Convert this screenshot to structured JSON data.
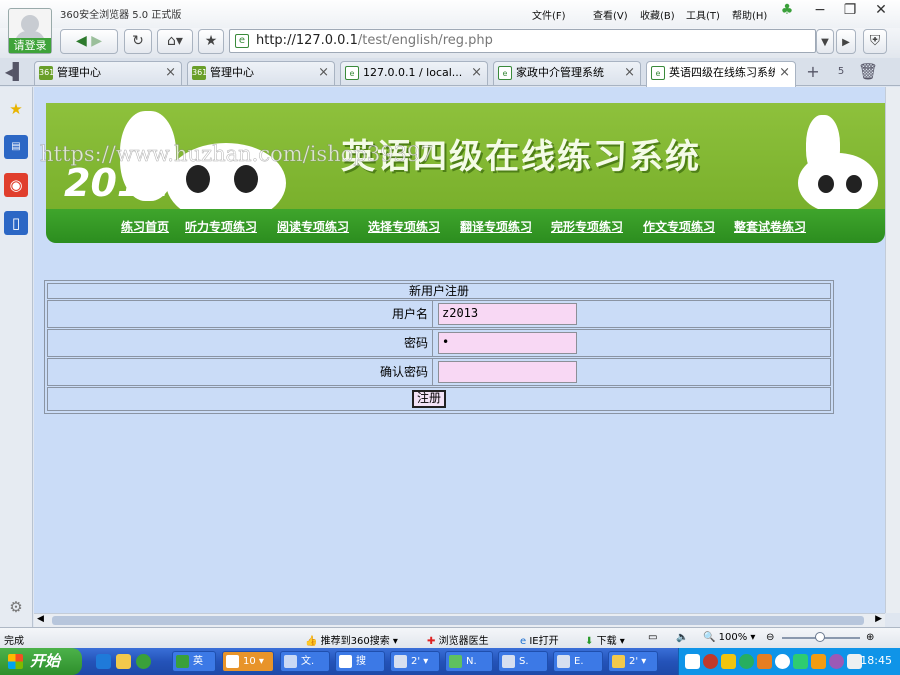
{
  "browser": {
    "app_title": "360安全浏览器 5.0 正式版",
    "login_label": "请登录",
    "menus": [
      "文件(F)",
      "查看(V)",
      "收藏(B)",
      "工具(T)",
      "帮助(H)"
    ],
    "url_host": "http://127.0.0.1",
    "url_path": "/test/english/reg.php",
    "tab_count": "5"
  },
  "tabs": [
    {
      "label": "管理中心",
      "icon": "360-icon"
    },
    {
      "label": "管理中心",
      "icon": "360-icon"
    },
    {
      "label": "127.0.0.1 / local...",
      "icon": "page-icon"
    },
    {
      "label": "家政中介管理系统",
      "icon": "page-icon"
    },
    {
      "label": "英语四级在线练习系统",
      "icon": "page-icon",
      "active": true
    }
  ],
  "page": {
    "banner_title": "英语四级在线练习系统",
    "banner_year": "2011",
    "watermark": "https://www.huzhan.com/ishop39397",
    "nav": [
      "练习首页",
      "听力专项练习",
      "阅读专项练习",
      "选择专项练习",
      "翻译专项练习",
      "完形专项练习",
      "作文专项练习",
      "整套试卷练习"
    ],
    "form": {
      "heading": "新用户注册",
      "username_label": "用户名",
      "username_value": "z2013",
      "password_label": "密码",
      "password_value": "•",
      "confirm_label": "确认密码",
      "confirm_value": "",
      "submit_label": "注册"
    }
  },
  "statusbar": {
    "status": "完成",
    "recommend": "推荐到360搜索",
    "doctor": "浏览器医生",
    "ie_open": "IE打开",
    "download": "下载",
    "zoom": "100%"
  },
  "taskbar": {
    "start": "开始",
    "buttons": [
      "英",
      "10",
      "文.",
      "搜",
      "2'",
      "N.",
      "S.",
      "E.",
      "2'"
    ],
    "clock": "18:45"
  },
  "colors": {
    "accent_green": "#3fa52c",
    "content_bg": "#cadcf7",
    "input_bg": "#f8d8f4",
    "taskbar_blue": "#2453b9"
  }
}
